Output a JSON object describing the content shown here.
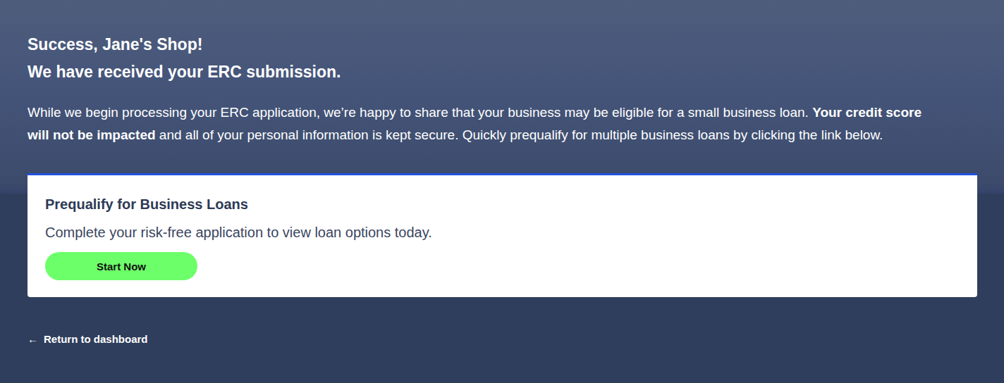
{
  "header": {
    "title_line1": "Success, Jane's Shop!",
    "title_line2": "We have received your ERC submission."
  },
  "intro": {
    "text_before": "While we begin processing your ERC application, we’re happy to share that your business may be eligible for a small business loan. ",
    "bold": "Your credit score will not be impacted",
    "text_after": " and all of your personal information is kept secure. Quickly prequalify for multiple business loans by clicking the link below."
  },
  "card": {
    "title": "Prequalify for Business Loans",
    "subtitle": "Complete your risk-free application to view loan options today.",
    "button": "Start Now"
  },
  "back_link": {
    "icon": "←",
    "label": "Return to dashboard"
  }
}
